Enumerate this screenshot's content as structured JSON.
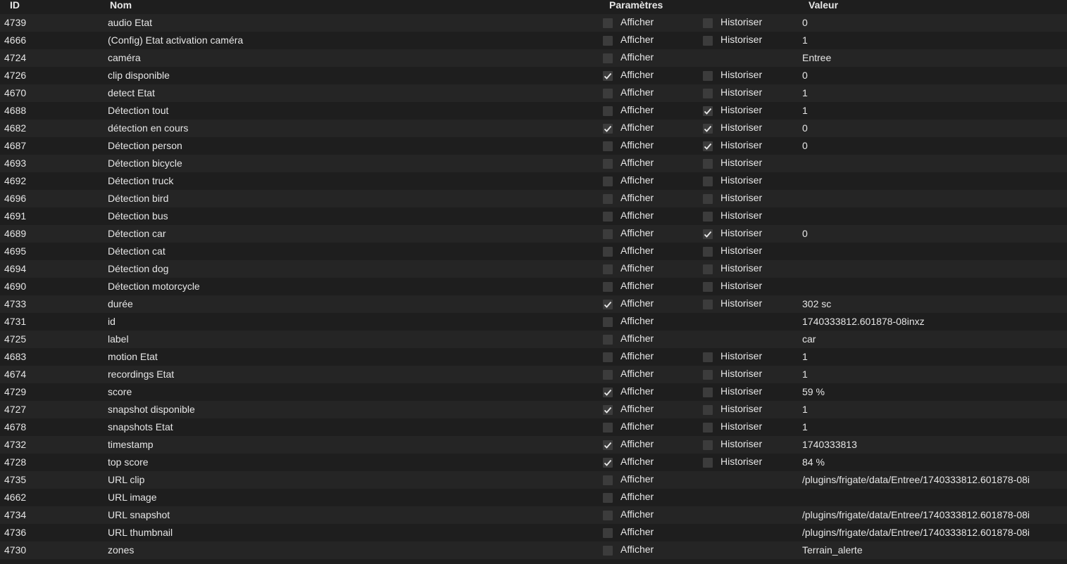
{
  "header": {
    "id": "ID",
    "nom": "Nom",
    "parametres": "Paramètres",
    "valeur": "Valeur"
  },
  "labels": {
    "afficher": "Afficher",
    "historiser": "Historiser"
  },
  "rows": [
    {
      "id": "4739",
      "nom": "audio Etat",
      "afficher": false,
      "historiser": false,
      "has_historiser": true,
      "valeur": "0"
    },
    {
      "id": "4666",
      "nom": "(Config) Etat activation caméra",
      "afficher": false,
      "historiser": false,
      "has_historiser": true,
      "valeur": "1"
    },
    {
      "id": "4724",
      "nom": "caméra",
      "afficher": false,
      "historiser": false,
      "has_historiser": false,
      "valeur": "Entree"
    },
    {
      "id": "4726",
      "nom": "clip disponible",
      "afficher": true,
      "historiser": false,
      "has_historiser": true,
      "valeur": "0"
    },
    {
      "id": "4670",
      "nom": "detect Etat",
      "afficher": false,
      "historiser": false,
      "has_historiser": true,
      "valeur": "1"
    },
    {
      "id": "4688",
      "nom": "Détection tout",
      "afficher": false,
      "historiser": true,
      "has_historiser": true,
      "valeur": "1"
    },
    {
      "id": "4682",
      "nom": "détection en cours",
      "afficher": true,
      "historiser": true,
      "has_historiser": true,
      "valeur": "0"
    },
    {
      "id": "4687",
      "nom": "Détection person",
      "afficher": false,
      "historiser": true,
      "has_historiser": true,
      "valeur": "0"
    },
    {
      "id": "4693",
      "nom": "Détection bicycle",
      "afficher": false,
      "historiser": false,
      "has_historiser": true,
      "valeur": ""
    },
    {
      "id": "4692",
      "nom": "Détection truck",
      "afficher": false,
      "historiser": false,
      "has_historiser": true,
      "valeur": ""
    },
    {
      "id": "4696",
      "nom": "Détection bird",
      "afficher": false,
      "historiser": false,
      "has_historiser": true,
      "valeur": ""
    },
    {
      "id": "4691",
      "nom": "Détection bus",
      "afficher": false,
      "historiser": false,
      "has_historiser": true,
      "valeur": ""
    },
    {
      "id": "4689",
      "nom": "Détection car",
      "afficher": false,
      "historiser": true,
      "has_historiser": true,
      "valeur": "0"
    },
    {
      "id": "4695",
      "nom": "Détection cat",
      "afficher": false,
      "historiser": false,
      "has_historiser": true,
      "valeur": ""
    },
    {
      "id": "4694",
      "nom": "Détection dog",
      "afficher": false,
      "historiser": false,
      "has_historiser": true,
      "valeur": ""
    },
    {
      "id": "4690",
      "nom": "Détection motorcycle",
      "afficher": false,
      "historiser": false,
      "has_historiser": true,
      "valeur": ""
    },
    {
      "id": "4733",
      "nom": "durée",
      "afficher": true,
      "historiser": false,
      "has_historiser": true,
      "valeur": "302 sc"
    },
    {
      "id": "4731",
      "nom": "id",
      "afficher": false,
      "historiser": false,
      "has_historiser": false,
      "valeur": "1740333812.601878-08inxz"
    },
    {
      "id": "4725",
      "nom": "label",
      "afficher": false,
      "historiser": false,
      "has_historiser": false,
      "valeur": "car"
    },
    {
      "id": "4683",
      "nom": "motion Etat",
      "afficher": false,
      "historiser": false,
      "has_historiser": true,
      "valeur": "1"
    },
    {
      "id": "4674",
      "nom": "recordings Etat",
      "afficher": false,
      "historiser": false,
      "has_historiser": true,
      "valeur": "1"
    },
    {
      "id": "4729",
      "nom": "score",
      "afficher": true,
      "historiser": false,
      "has_historiser": true,
      "valeur": "59 %"
    },
    {
      "id": "4727",
      "nom": "snapshot disponible",
      "afficher": true,
      "historiser": false,
      "has_historiser": true,
      "valeur": "1"
    },
    {
      "id": "4678",
      "nom": "snapshots Etat",
      "afficher": false,
      "historiser": false,
      "has_historiser": true,
      "valeur": "1"
    },
    {
      "id": "4732",
      "nom": "timestamp",
      "afficher": true,
      "historiser": false,
      "has_historiser": true,
      "valeur": "1740333813"
    },
    {
      "id": "4728",
      "nom": "top score",
      "afficher": true,
      "historiser": false,
      "has_historiser": true,
      "valeur": "84 %"
    },
    {
      "id": "4735",
      "nom": "URL clip",
      "afficher": false,
      "historiser": false,
      "has_historiser": false,
      "valeur": "/plugins/frigate/data/Entree/1740333812.601878-08i"
    },
    {
      "id": "4662",
      "nom": "URL image",
      "afficher": false,
      "historiser": false,
      "has_historiser": false,
      "valeur": ""
    },
    {
      "id": "4734",
      "nom": "URL snapshot",
      "afficher": false,
      "historiser": false,
      "has_historiser": false,
      "valeur": "/plugins/frigate/data/Entree/1740333812.601878-08i"
    },
    {
      "id": "4736",
      "nom": "URL thumbnail",
      "afficher": false,
      "historiser": false,
      "has_historiser": false,
      "valeur": "/plugins/frigate/data/Entree/1740333812.601878-08i"
    },
    {
      "id": "4730",
      "nom": "zones",
      "afficher": false,
      "historiser": false,
      "has_historiser": false,
      "valeur": "Terrain_alerte"
    }
  ]
}
